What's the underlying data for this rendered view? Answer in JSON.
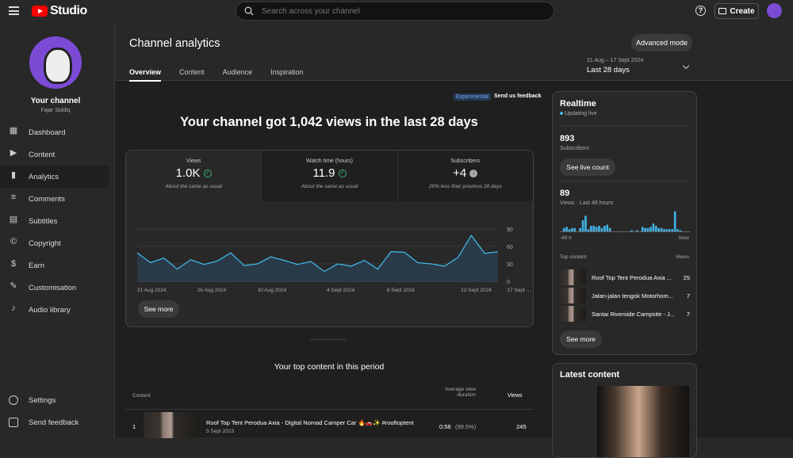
{
  "topbar": {
    "brand": "Studio",
    "search_placeholder": "Search across your channel",
    "help_icon": "?",
    "create_label": "Create"
  },
  "channel": {
    "label": "Your channel",
    "name": "Fajar Siddiq"
  },
  "sidebar": {
    "items": [
      {
        "label": "Dashboard",
        "icon": "dashboard-icon"
      },
      {
        "label": "Content",
        "icon": "content-icon"
      },
      {
        "label": "Analytics",
        "icon": "analytics-icon",
        "active": true
      },
      {
        "label": "Comments",
        "icon": "comments-icon"
      },
      {
        "label": "Subtitles",
        "icon": "subtitles-icon"
      },
      {
        "label": "Copyright",
        "icon": "copyright-icon"
      },
      {
        "label": "Earn",
        "icon": "earn-icon"
      },
      {
        "label": "Customisation",
        "icon": "customisation-icon"
      },
      {
        "label": "Audio library",
        "icon": "audio-library-icon"
      }
    ],
    "settings": "Settings",
    "feedback": "Send feedback"
  },
  "header": {
    "title": "Channel analytics",
    "advanced": "Advanced mode",
    "tabs": [
      "Overview",
      "Content",
      "Audience",
      "Inspiration"
    ],
    "period_range": "21 Aug – 17 Sept 2024",
    "period_label": "Last 28 days"
  },
  "overview": {
    "experimental": "Experimental",
    "feedback": "Send us feedback",
    "headline": "Your channel got 1,042 views in the last 28 days",
    "kpis": [
      {
        "label": "Views",
        "value": "1.0K",
        "sub": "About the same as usual"
      },
      {
        "label": "Watch time (hours)",
        "value": "11.9",
        "sub": "About the same as usual"
      },
      {
        "label": "Subscribers",
        "value": "+4",
        "sub": "20% less than previous 28 days"
      }
    ],
    "see_more": "See more"
  },
  "chart_data": {
    "type": "area",
    "title": "Views",
    "x_tick_labels": [
      "21 Aug 2024",
      "26 Aug 2024",
      "30 Aug 2024",
      "4 Sept 2024",
      "8 Sept 2024",
      "13 Sept 2024",
      "17 Sept ..."
    ],
    "y_ticks": [
      0,
      30,
      60,
      90
    ],
    "ylim": [
      0,
      90
    ],
    "values": [
      49,
      32,
      40,
      21,
      37,
      29,
      35,
      49,
      27,
      30,
      42,
      36,
      29,
      34,
      17,
      30,
      26,
      36,
      21,
      51,
      50,
      32,
      30,
      26,
      41,
      79,
      48,
      51
    ],
    "color": "#41b4e4"
  },
  "top_content": {
    "title": "Your top content in this period",
    "col_content": "Content",
    "col_avd": "Average view duration",
    "col_views": "Views",
    "rows": [
      {
        "rank": "1",
        "title": "Roof Top Tent Perodua Axia - Digital Nomad Camper Car 🔥🚗✨ #rooftoptent",
        "date": "5 Sept 2023",
        "avd": "0:58",
        "avd_pct": "(99.5%)",
        "views": "245"
      }
    ]
  },
  "realtime": {
    "title": "Realtime",
    "status": "Updating live",
    "subs": "893",
    "subs_label": "Subscribers",
    "live_count": "See live count",
    "views": "89",
    "views_label": "Views · Last 48 hours",
    "axis_start": "-48 h",
    "axis_end": "Now",
    "bars": [
      0,
      3,
      4,
      2,
      3,
      3,
      0,
      3,
      10,
      14,
      2,
      5,
      5,
      4,
      5,
      3,
      5,
      6,
      3,
      0,
      0,
      0,
      0,
      0,
      0,
      0,
      1,
      0,
      1,
      0,
      4,
      3,
      3,
      4,
      7,
      5,
      3,
      3,
      2,
      2,
      2,
      2,
      18,
      2,
      1,
      0,
      0,
      0
    ],
    "top_label": "Top content",
    "views_col": "Views",
    "top": [
      {
        "title": "Roof Top Tent Perodua Axia ...",
        "views": "25"
      },
      {
        "title": "Jalan-jalan tengok Motorhom...",
        "views": "7"
      },
      {
        "title": "Santai Riverside Campsite - J...",
        "views": "7"
      }
    ],
    "see_more": "See more"
  },
  "latest": {
    "title": "Latest content"
  }
}
